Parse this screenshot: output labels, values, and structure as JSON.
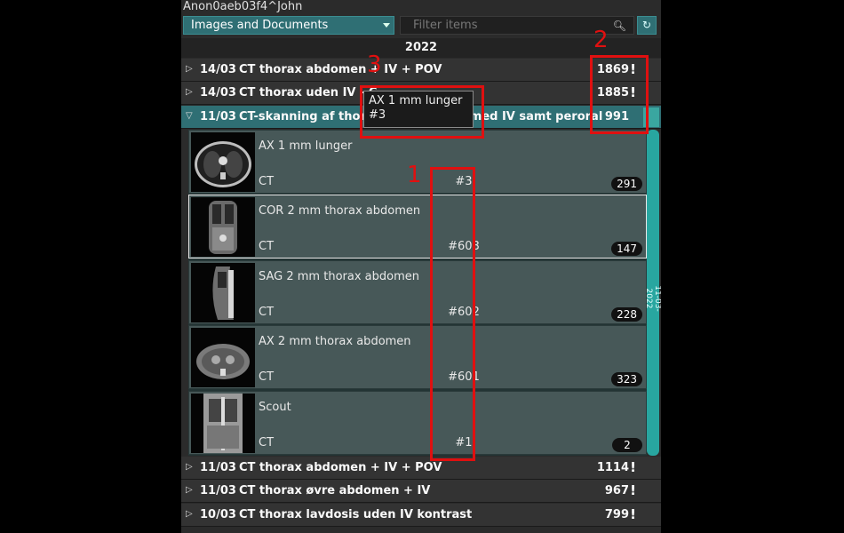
{
  "patient": {
    "name": "Anon0aeb03f4^John"
  },
  "toolbar": {
    "dropdown_value": "Images and Documents",
    "filter_placeholder": "Filter items"
  },
  "year": "2022",
  "studies_top": [
    {
      "date": "14/03",
      "desc": "CT thorax abdomen + IV + POV",
      "count": "1869"
    },
    {
      "date": "14/03",
      "desc": "CT thorax uden IV - C",
      "count": "1885"
    }
  ],
  "expanded_study": {
    "date": "11/03",
    "desc": "CT-skanning af thorax og abdomen med IV samt peroral kontrast",
    "count": "991",
    "vertical_date": "11-03-2022"
  },
  "series": [
    {
      "name": "AX 1 mm lunger",
      "modality": "CT",
      "number": "#3",
      "count": "291"
    },
    {
      "name": "COR 2 mm thorax abdomen",
      "modality": "CT",
      "number": "#603",
      "count": "147"
    },
    {
      "name": "SAG 2 mm thorax abdomen",
      "modality": "CT",
      "number": "#602",
      "count": "228"
    },
    {
      "name": "AX 2 mm thorax abdomen",
      "modality": "CT",
      "number": "#601",
      "count": "323"
    },
    {
      "name": "Scout",
      "modality": "CT",
      "number": "#1",
      "count": "2"
    }
  ],
  "studies_bottom": [
    {
      "date": "11/03",
      "desc": "CT thorax abdomen + IV + POV",
      "count": "1114"
    },
    {
      "date": "11/03",
      "desc": "CT thorax øvre abdomen + IV",
      "count": "967"
    },
    {
      "date": "10/03",
      "desc": "CT thorax lavdosis uden IV kontrast",
      "count": "799"
    }
  ],
  "tooltip": {
    "line1": "AX 1 mm lunger",
    "line2": "#3"
  },
  "annotations": {
    "label1": "1",
    "label2": "2",
    "label3": "3"
  },
  "colors": {
    "accent": "#2f6f74",
    "annotation": "#e01010",
    "scrollbar": "#28a6a0"
  }
}
